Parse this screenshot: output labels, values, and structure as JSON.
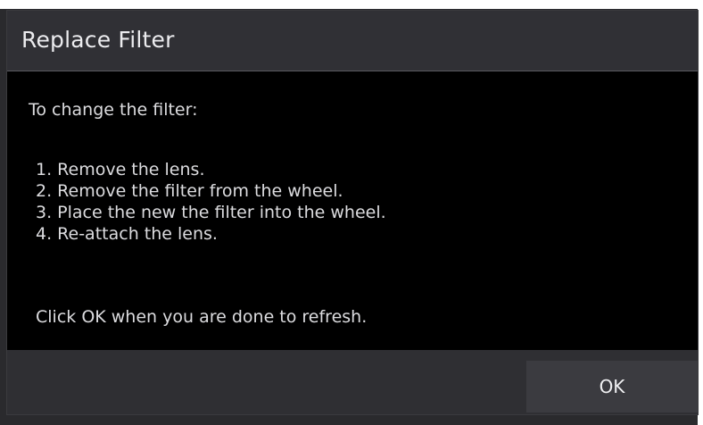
{
  "dialog": {
    "title": "Replace Filter",
    "intro": "To change the filter:",
    "steps": [
      "1. Remove the lens.",
      "2. Remove the filter from the wheel.",
      "3. Place the new the filter into the wheel.",
      "4. Re-attach the lens."
    ],
    "closing": "Click OK when you are done to refresh.",
    "ok_label": "OK"
  }
}
